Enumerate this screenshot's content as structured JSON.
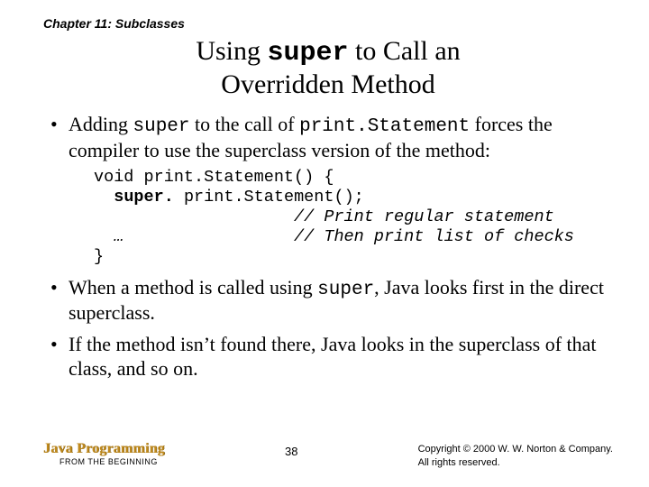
{
  "chapter": "Chapter 11: Subclasses",
  "title": {
    "line1_pre": "Using ",
    "line1_mono": "super",
    "line1_post": " to Call an",
    "line2": "Overridden Method"
  },
  "bullets": {
    "b1": {
      "pre": "Adding ",
      "mono1": "super",
      "mid": " to the call of ",
      "mono2": "print.Statement",
      "post": " forces the compiler to use the superclass version of the method:"
    },
    "b2": {
      "pre": "When a method is called using ",
      "mono": "super",
      "post": ", Java looks first in the direct superclass."
    },
    "b3": "If the method isn’t found there, Java looks in the superclass of that class, and so on."
  },
  "code": {
    "l1": "void print.Statement() {",
    "l2_indent": "  ",
    "l2_bold": "super.",
    "l2_rest": " print.Statement();",
    "l3": "                    // Print regular statement",
    "l4": "  …                 // Then print list of checks",
    "l5": "}"
  },
  "footer": {
    "brand": "Java Programming",
    "tagline": "FROM THE BEGINNING",
    "pagenum": "38",
    "copy1": "Copyright © 2000 W. W. Norton & Company.",
    "copy2": "All rights reserved."
  }
}
